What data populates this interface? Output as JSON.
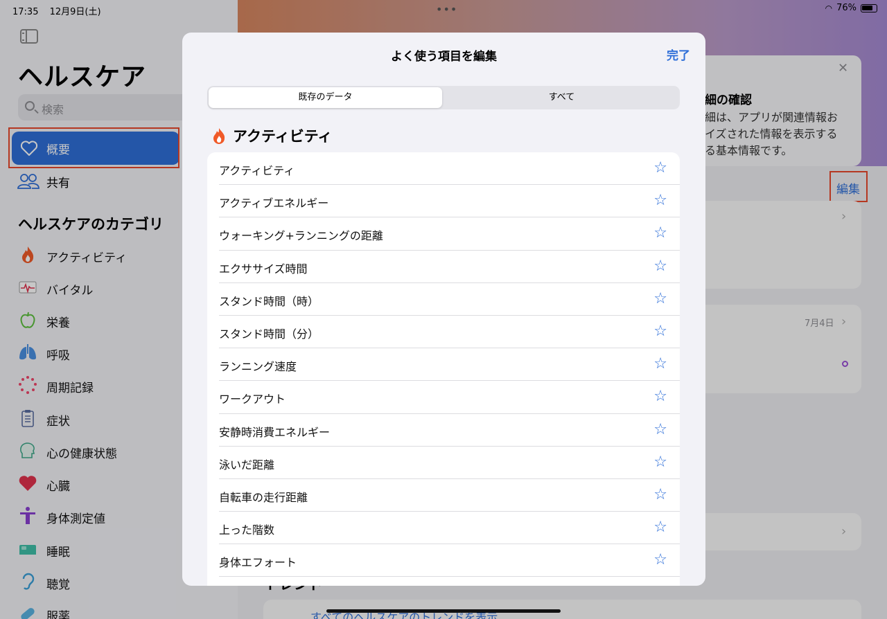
{
  "status_bar": {
    "time": "17:35",
    "date": "12月9日(土)",
    "battery": "76%"
  },
  "sidebar": {
    "title": "ヘルスケア",
    "search_placeholder": "検索",
    "nav": [
      {
        "label": "概要",
        "icon": "heart-outline-icon",
        "active": true
      },
      {
        "label": "共有",
        "icon": "people-icon",
        "active": false
      }
    ],
    "categories_heading": "ヘルスケアのカテゴリ",
    "categories": [
      {
        "label": "アクティビティ",
        "icon": "flame-icon"
      },
      {
        "label": "バイタル",
        "icon": "vitals-icon"
      },
      {
        "label": "栄養",
        "icon": "apple-icon"
      },
      {
        "label": "呼吸",
        "icon": "lungs-icon"
      },
      {
        "label": "周期記録",
        "icon": "cycle-icon"
      },
      {
        "label": "症状",
        "icon": "clipboard-icon"
      },
      {
        "label": "心の健康状態",
        "icon": "head-icon"
      },
      {
        "label": "心臓",
        "icon": "heart-icon"
      },
      {
        "label": "身体測定値",
        "icon": "body-icon"
      },
      {
        "label": "睡眠",
        "icon": "bed-icon"
      },
      {
        "label": "聴覚",
        "icon": "ear-icon"
      },
      {
        "label": "服薬",
        "icon": "pill-icon"
      }
    ]
  },
  "background": {
    "card_title": "細の確認",
    "card_lines": [
      "細は、アプリが関連情報お",
      "イズされた情報を表示する",
      "る基本情報です。"
    ],
    "edit_label": "編集",
    "date_label": "7月4日",
    "trend_heading": "トレンド",
    "trend_row": "すべてのヘルスケアのトレンドを表示"
  },
  "modal": {
    "title": "よく使う項目を編集",
    "done_label": "完了",
    "segments": [
      "既存のデータ",
      "すべて"
    ],
    "section_title": "アクティビティ",
    "items": [
      "アクティビティ",
      "アクティブエネルギー",
      "ウォーキング+ランニングの距離",
      "エクササイズ時間",
      "スタンド時間（時）",
      "スタンド時間（分）",
      "ランニング速度",
      "ワークアウト",
      "安静時消費エネルギー",
      "泳いだ距離",
      "自転車の走行距離",
      "上った階数",
      "身体エフォート"
    ]
  },
  "colors": {
    "accent": "#2f6fd8",
    "highlight": "#e8472b",
    "flame": "#f05a28"
  }
}
